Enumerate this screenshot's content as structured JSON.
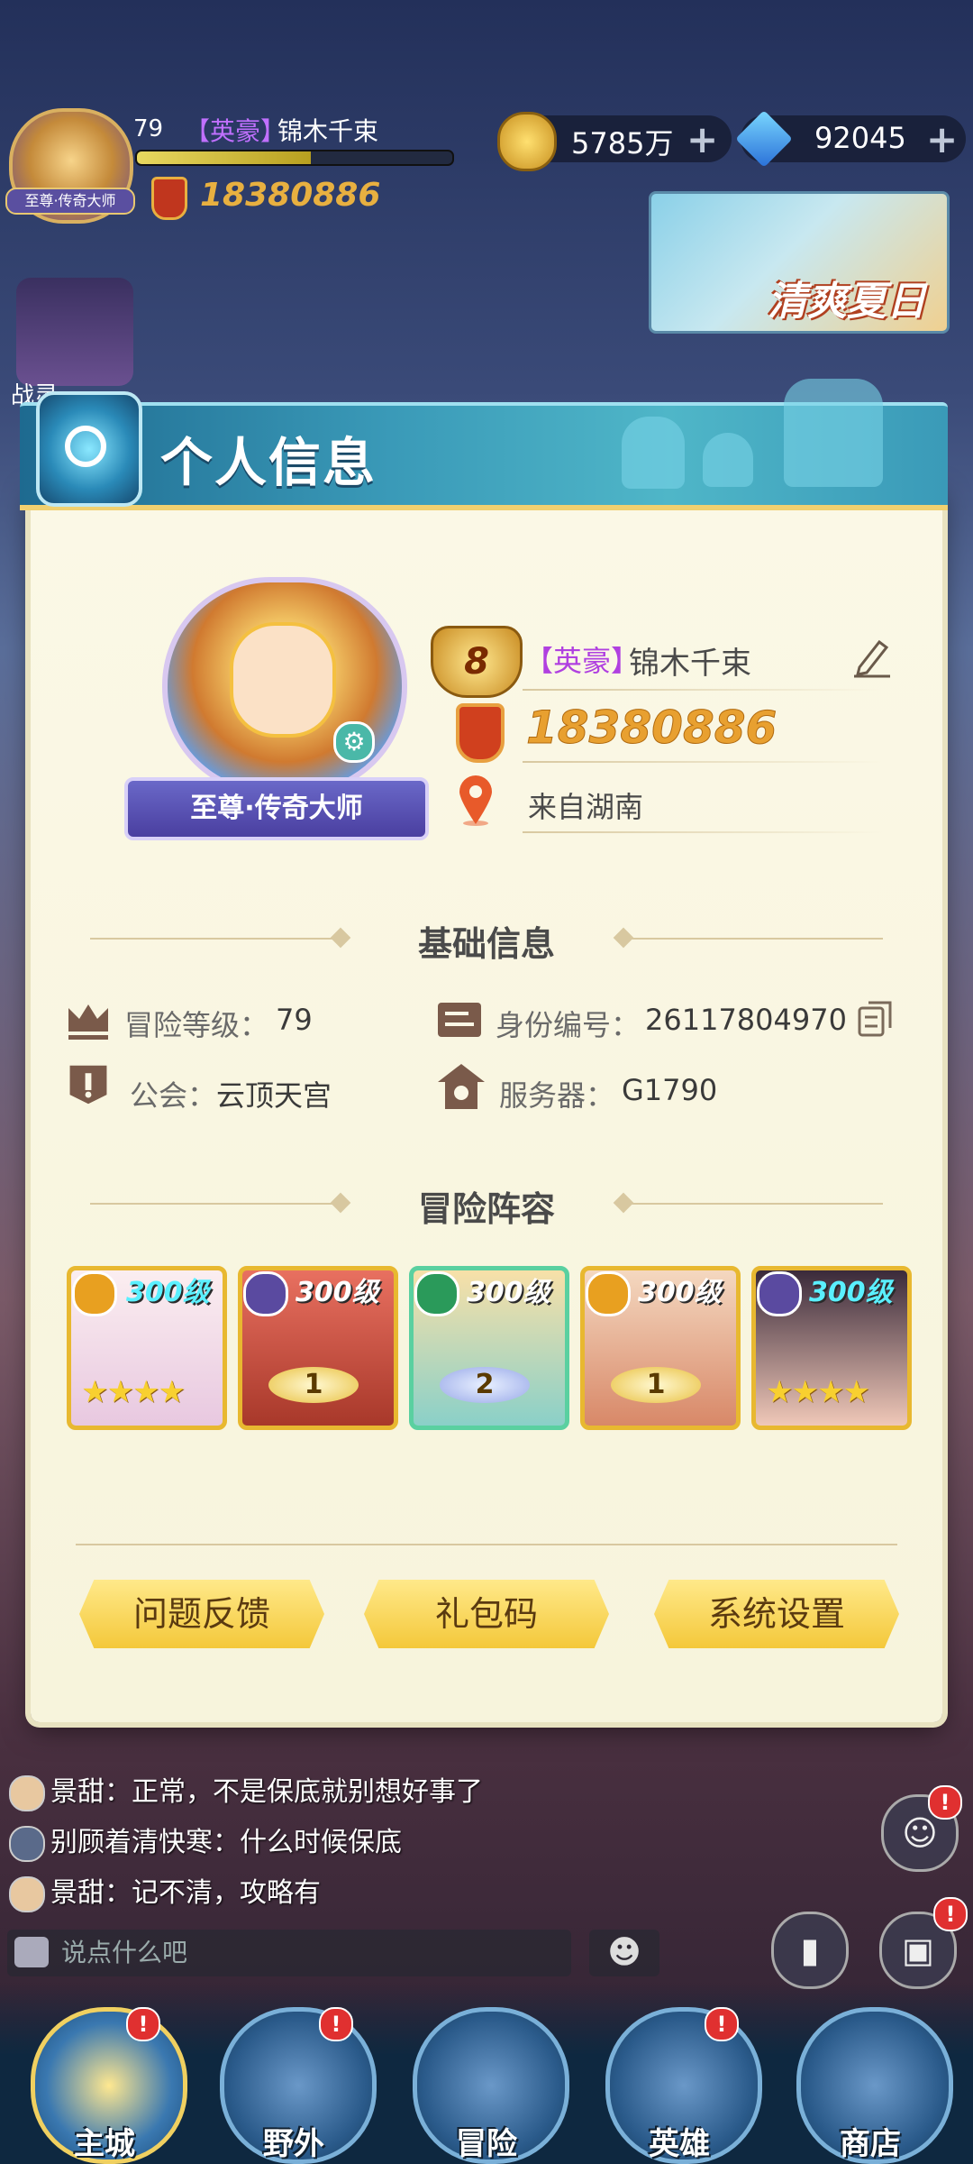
{
  "hud": {
    "level": "79",
    "title": "【英豪】",
    "name": "锦木千束",
    "avatar_badge": "至尊·传奇大师",
    "power": "18380886",
    "exp_progress": 0.55,
    "gold": "5785万",
    "gems": "92045",
    "plus_glyph": "+",
    "banner_text": "清爽夏日",
    "side_widget_text": "战灵"
  },
  "dialog": {
    "title": "个人信息",
    "profile": {
      "rank_title": "至尊·传奇大师",
      "vip_level": "8",
      "title_tag": "【英豪】",
      "name": "锦木千束",
      "power": "18380886",
      "location": "来自湖南"
    },
    "basic_info": {
      "heading": "基础信息",
      "adventure_level_label": "冒险等级：",
      "adventure_level": "79",
      "id_label": "身份编号：",
      "id_value": "26117804970",
      "guild_label": "公会：",
      "guild_value": "云顶天宫",
      "server_label": "服务器：",
      "server_value": "G1790"
    },
    "lineup": {
      "heading": "冒险阵容",
      "heroes": [
        {
          "level": "300级",
          "stars": "★★★★",
          "wing": ""
        },
        {
          "level": "300级",
          "stars": "",
          "wing": "1"
        },
        {
          "level": "300级",
          "stars": "",
          "wing": "2"
        },
        {
          "level": "300级",
          "stars": "",
          "wing": "1"
        },
        {
          "level": "300级",
          "stars": "★★★★",
          "wing": ""
        }
      ]
    },
    "buttons": {
      "feedback": "问题反馈",
      "gift_code": "礼包码",
      "settings": "系统设置"
    }
  },
  "chat": {
    "lines": [
      {
        "user": "景甜",
        "text": "景甜：正常，不是保底就别想好事了"
      },
      {
        "user": "别顾着清快寒",
        "text": "别顾着清快寒：什么时候保底"
      },
      {
        "user": "景甜",
        "text": "景甜：记不清，攻略有"
      }
    ],
    "input_placeholder": "说点什么吧",
    "emoji_glyph": "☻"
  },
  "nav": {
    "items": [
      {
        "label": "主城",
        "badge": "!"
      },
      {
        "label": "野外",
        "badge": "!"
      },
      {
        "label": "冒险",
        "badge": ""
      },
      {
        "label": "英雄",
        "badge": "!"
      },
      {
        "label": "商店",
        "badge": ""
      }
    ]
  },
  "colors": {
    "header_blue": "#3a9ab8",
    "panel_cream": "#f7f4dc",
    "button_yellow": "#f4c83a",
    "gold_text": "#e8a030",
    "title_purple": "#b040e0"
  }
}
